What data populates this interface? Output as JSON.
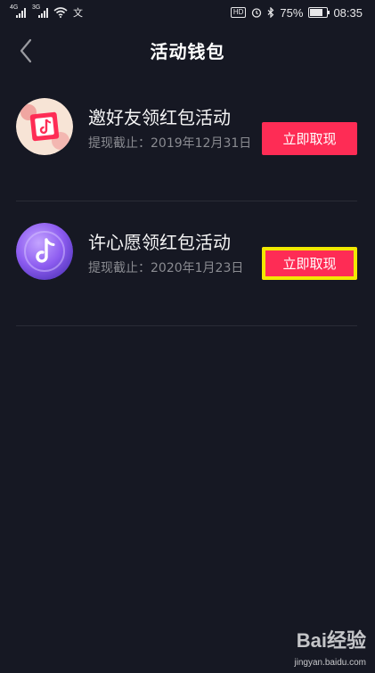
{
  "status_bar": {
    "net1": "4G",
    "net2": "3G",
    "app_icon": "文",
    "hd": "HD",
    "battery_percent": "75%",
    "battery_level": 0.75,
    "time": "08:35"
  },
  "header": {
    "title": "活动钱包"
  },
  "activities": [
    {
      "icon": "tiktok-gift-box-icon",
      "title": "邀好友领红包活动",
      "deadline": "提现截止：2019年12月31日",
      "button": "立即取现"
    },
    {
      "icon": "tiktok-purple-circle-icon",
      "title": "许心愿领红包活动",
      "deadline": "提现截止：2020年1月23日",
      "button": "立即取现",
      "highlighted": true
    }
  ],
  "colors": {
    "background": "#161823",
    "accent": "#fe2c55",
    "highlight_border": "#f2e800",
    "secondary_text": "#8a8b91"
  },
  "watermark": {
    "logo": "Bai经验",
    "url": "jingyan.baidu.com"
  }
}
